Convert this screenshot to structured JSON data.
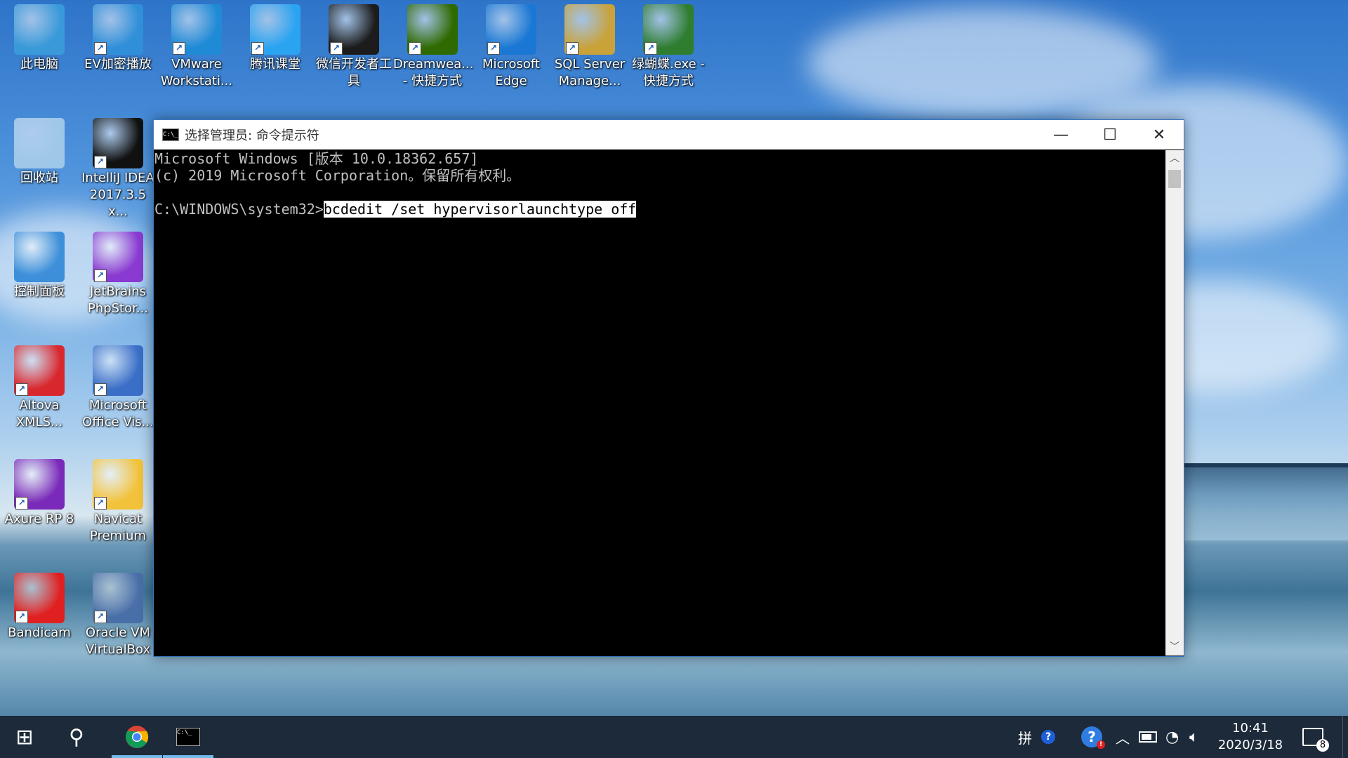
{
  "desktop": {
    "icons": [
      {
        "label": "此电脑",
        "name": "this-pc",
        "color": "#3a9ad9"
      },
      {
        "label": "EV加密播放",
        "name": "ev-player",
        "color": "#2f8fd8"
      },
      {
        "label": "VMware\nWorkstati...",
        "name": "vmware",
        "color": "#1f8ad6"
      },
      {
        "label": "腾讯课堂",
        "name": "tencent-classroom",
        "color": "#2aa3f0"
      },
      {
        "label": "微信开发者工\n具",
        "name": "wechat-devtools",
        "color": "#1c1c1c"
      },
      {
        "label": "Dreamwea...\n- 快捷方式",
        "name": "dreamweaver",
        "color": "#2f6a00"
      },
      {
        "label": "Microsoft\nEdge",
        "name": "edge",
        "color": "#1a78d4"
      },
      {
        "label": "SQL Server\nManage...",
        "name": "sql-server",
        "color": "#c9a23a"
      },
      {
        "label": "绿蝴蝶.exe -\n快捷方式",
        "name": "green-butterfly",
        "color": "#2f7d2f"
      },
      {
        "label": "回收站",
        "name": "recycle-bin",
        "color": "#9fc7e8"
      },
      {
        "label": "IntelliJ IDEA\n2017.3.5 x...",
        "name": "intellij",
        "color": "#111111"
      },
      {
        "label": "控制面板",
        "name": "control-panel",
        "color": "#3d8fd9"
      },
      {
        "label": "JetBrains\nPhpStor...",
        "name": "phpstorm",
        "color": "#8a3ad1"
      },
      {
        "label": "Altova\nXMLS...",
        "name": "altova",
        "color": "#d9272e"
      },
      {
        "label": "Microsoft\nOffice Vis...",
        "name": "office-visio",
        "color": "#3a6ec7"
      },
      {
        "label": "Axure RP 8",
        "name": "axure",
        "color": "#7a2ab8"
      },
      {
        "label": "Navicat\nPremium",
        "name": "navicat",
        "color": "#f2c23a"
      },
      {
        "label": "Bandicam",
        "name": "bandicam",
        "color": "#e02020"
      },
      {
        "label": "Oracle VM\nVirtualBox",
        "name": "virtualbox",
        "color": "#4a6fa8"
      }
    ]
  },
  "cmd": {
    "title": "选择管理员: 命令提示符",
    "icon_text": "C:\\_",
    "line1": "Microsoft Windows [版本 10.0.18362.657]",
    "line2": "(c) 2019 Microsoft Corporation。保留所有权利。",
    "prompt": "C:\\WINDOWS\\system32>",
    "command": "bcdedit /set hypervisorlaunchtype off",
    "minimize": "—",
    "maximize": "☐",
    "close": "✕",
    "scroll_up": "︿",
    "scroll_down": "﹀"
  },
  "taskbar": {
    "start": "⊞",
    "search": "⚲",
    "ime": "拼",
    "clock_time": "10:41",
    "clock_date": "2020/3/18",
    "notification_count": "8"
  },
  "colors": {
    "accent": "#76b9ed",
    "taskbar": "#1c2a3a",
    "console_text": "#c0c0c0"
  }
}
